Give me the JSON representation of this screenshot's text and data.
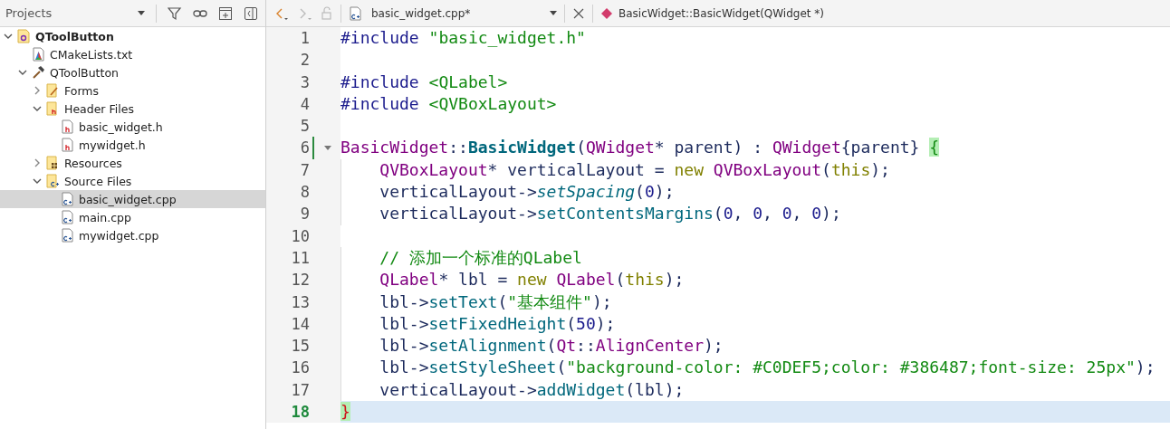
{
  "sidebar": {
    "title": "Projects",
    "tree": [
      {
        "label": "QToolButton",
        "kind": "project",
        "expanded": true,
        "selected": false,
        "children": [
          {
            "label": "CMakeLists.txt",
            "kind": "cmake",
            "selected": false
          },
          {
            "label": "QToolButton",
            "kind": "target",
            "expanded": true,
            "selected": false,
            "children": [
              {
                "label": "Forms",
                "kind": "forms",
                "expanded": false,
                "selected": false
              },
              {
                "label": "Header Files",
                "kind": "headers",
                "expanded": true,
                "selected": false,
                "children": [
                  {
                    "label": "basic_widget.h",
                    "kind": "header",
                    "selected": false
                  },
                  {
                    "label": "mywidget.h",
                    "kind": "header",
                    "selected": false
                  }
                ]
              },
              {
                "label": "Resources",
                "kind": "resources",
                "expanded": false,
                "selected": false
              },
              {
                "label": "Source Files",
                "kind": "sources",
                "expanded": true,
                "selected": false,
                "children": [
                  {
                    "label": "basic_widget.cpp",
                    "kind": "source",
                    "selected": true
                  },
                  {
                    "label": "main.cpp",
                    "kind": "source",
                    "selected": false
                  },
                  {
                    "label": "mywidget.cpp",
                    "kind": "source",
                    "selected": false
                  }
                ]
              }
            ]
          }
        ]
      }
    ]
  },
  "editor_toolbar": {
    "back_disabled": false,
    "forward_disabled": true,
    "file_name": "basic_widget.cpp*",
    "symbol": "BasicWidget::BasicWidget(QWidget *)"
  },
  "code_lines": [
    {
      "number": "1",
      "current": false,
      "changed": false,
      "foldable": false,
      "indented": false,
      "tokens": [
        {
          "kind": "preproc",
          "text": "#include "
        },
        {
          "kind": "string",
          "text": "\"basic_widget.h\""
        }
      ]
    },
    {
      "number": "2",
      "current": false,
      "changed": false,
      "foldable": false,
      "indented": false
    },
    {
      "number": "3",
      "current": false,
      "changed": false,
      "foldable": false,
      "indented": false,
      "tokens": [
        {
          "kind": "preproc",
          "text": "#include "
        },
        {
          "kind": "string",
          "text": "<QLabel>"
        }
      ]
    },
    {
      "number": "4",
      "current": false,
      "changed": false,
      "foldable": false,
      "indented": false,
      "tokens": [
        {
          "kind": "preproc",
          "text": "#include "
        },
        {
          "kind": "string",
          "text": "<QVBoxLayout>"
        }
      ]
    },
    {
      "number": "5",
      "current": false,
      "changed": false,
      "foldable": false,
      "indented": false
    },
    {
      "number": "6",
      "current": false,
      "changed": true,
      "foldable": true,
      "indented": false,
      "tokens": [
        {
          "kind": "type",
          "text": "BasicWidget"
        },
        {
          "kind": "plain",
          "text": "::"
        },
        {
          "kind": "declaration",
          "text": "BasicWidget"
        },
        {
          "kind": "plain",
          "text": "("
        },
        {
          "kind": "type",
          "text": "QWidget"
        },
        {
          "kind": "plain",
          "text": "* parent) : "
        },
        {
          "kind": "type",
          "text": "QWidget"
        },
        {
          "kind": "plain",
          "text": "{parent} "
        },
        {
          "kind": "brace_match",
          "text": "{"
        }
      ]
    },
    {
      "number": "7",
      "current": false,
      "changed": false,
      "foldable": false,
      "indented": true,
      "tokens": [
        {
          "kind": "type",
          "text": "QVBoxLayout"
        },
        {
          "kind": "plain",
          "text": "* verticalLayout = "
        },
        {
          "kind": "keyword",
          "text": "new "
        },
        {
          "kind": "type",
          "text": "QVBoxLayout"
        },
        {
          "kind": "plain",
          "text": "("
        },
        {
          "kind": "keyword",
          "text": "this"
        },
        {
          "kind": "plain",
          "text": ");"
        }
      ]
    },
    {
      "number": "8",
      "current": false,
      "changed": false,
      "foldable": false,
      "indented": true,
      "tokens": [
        {
          "kind": "plain",
          "text": "verticalLayout->"
        },
        {
          "kind": "virtual",
          "text": "setSpacing"
        },
        {
          "kind": "plain",
          "text": "("
        },
        {
          "kind": "number",
          "text": "0"
        },
        {
          "kind": "plain",
          "text": ");"
        }
      ]
    },
    {
      "number": "9",
      "current": false,
      "changed": false,
      "foldable": false,
      "indented": true,
      "tokens": [
        {
          "kind": "plain",
          "text": "verticalLayout->"
        },
        {
          "kind": "function",
          "text": "setContentsMargins"
        },
        {
          "kind": "plain",
          "text": "("
        },
        {
          "kind": "number",
          "text": "0"
        },
        {
          "kind": "plain",
          "text": ", "
        },
        {
          "kind": "number",
          "text": "0"
        },
        {
          "kind": "plain",
          "text": ", "
        },
        {
          "kind": "number",
          "text": "0"
        },
        {
          "kind": "plain",
          "text": ", "
        },
        {
          "kind": "number",
          "text": "0"
        },
        {
          "kind": "plain",
          "text": ");"
        }
      ]
    },
    {
      "number": "10",
      "current": false,
      "changed": false,
      "foldable": false,
      "indented": false
    },
    {
      "number": "11",
      "current": false,
      "changed": false,
      "foldable": false,
      "indented": true,
      "tokens": [
        {
          "kind": "comment",
          "text": "// 添加一个标准的QLabel"
        }
      ]
    },
    {
      "number": "12",
      "current": false,
      "changed": false,
      "foldable": false,
      "indented": true,
      "tokens": [
        {
          "kind": "type",
          "text": "QLabel"
        },
        {
          "kind": "plain",
          "text": "* lbl = "
        },
        {
          "kind": "keyword",
          "text": "new "
        },
        {
          "kind": "type",
          "text": "QLabel"
        },
        {
          "kind": "plain",
          "text": "("
        },
        {
          "kind": "keyword",
          "text": "this"
        },
        {
          "kind": "plain",
          "text": ");"
        }
      ]
    },
    {
      "number": "13",
      "current": false,
      "changed": false,
      "foldable": false,
      "indented": true,
      "tokens": [
        {
          "kind": "plain",
          "text": "lbl->"
        },
        {
          "kind": "function",
          "text": "setText"
        },
        {
          "kind": "plain",
          "text": "("
        },
        {
          "kind": "string",
          "text": "\"基本组件\""
        },
        {
          "kind": "plain",
          "text": ");"
        }
      ]
    },
    {
      "number": "14",
      "current": false,
      "changed": false,
      "foldable": false,
      "indented": true,
      "tokens": [
        {
          "kind": "plain",
          "text": "lbl->"
        },
        {
          "kind": "function",
          "text": "setFixedHeight"
        },
        {
          "kind": "plain",
          "text": "("
        },
        {
          "kind": "number",
          "text": "50"
        },
        {
          "kind": "plain",
          "text": ");"
        }
      ]
    },
    {
      "number": "15",
      "current": false,
      "changed": false,
      "foldable": false,
      "indented": true,
      "tokens": [
        {
          "kind": "plain",
          "text": "lbl->"
        },
        {
          "kind": "function",
          "text": "setAlignment"
        },
        {
          "kind": "plain",
          "text": "("
        },
        {
          "kind": "type",
          "text": "Qt"
        },
        {
          "kind": "plain",
          "text": "::"
        },
        {
          "kind": "type",
          "text": "AlignCenter"
        },
        {
          "kind": "plain",
          "text": ");"
        }
      ]
    },
    {
      "number": "16",
      "current": false,
      "changed": false,
      "foldable": false,
      "indented": true,
      "tokens": [
        {
          "kind": "plain",
          "text": "lbl->"
        },
        {
          "kind": "function",
          "text": "setStyleSheet"
        },
        {
          "kind": "plain",
          "text": "("
        },
        {
          "kind": "string",
          "text": "\"background-color: #C0DEF5;color: #386487;font-size: 25px\""
        },
        {
          "kind": "plain",
          "text": ");"
        }
      ]
    },
    {
      "number": "17",
      "current": false,
      "changed": false,
      "foldable": false,
      "indented": true,
      "tokens": [
        {
          "kind": "plain",
          "text": "verticalLayout->"
        },
        {
          "kind": "function",
          "text": "addWidget"
        },
        {
          "kind": "plain",
          "text": "(lbl);"
        }
      ]
    },
    {
      "number": "18",
      "current": true,
      "changed": false,
      "foldable": false,
      "indented": false,
      "tokens": [
        {
          "kind": "brace_mismatch",
          "text": "}"
        }
      ]
    }
  ]
}
